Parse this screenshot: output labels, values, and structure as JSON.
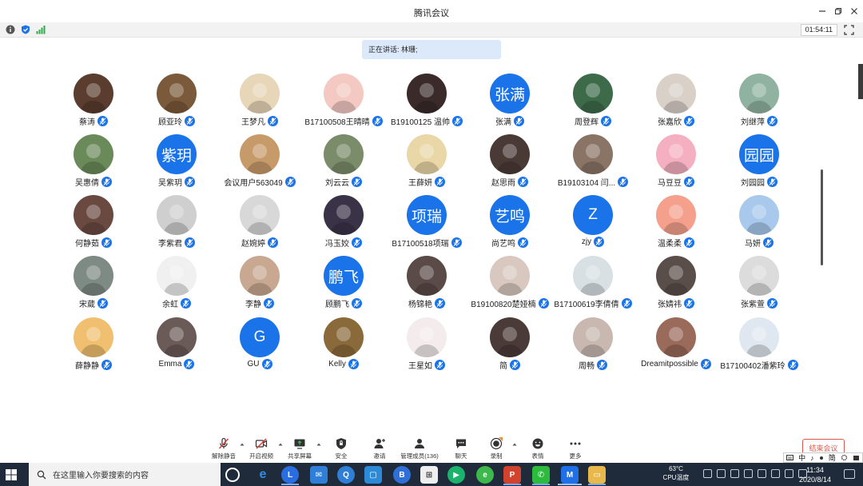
{
  "window": {
    "title": "腾讯会议",
    "timer": "01:54:11"
  },
  "speaking": {
    "text": "正在讲话: 林珊;"
  },
  "participants": [
    {
      "name": "蔡涛",
      "avatar_text": "",
      "avatar_color": "#5a3d2e"
    },
    {
      "name": "顾亚玲",
      "avatar_text": "",
      "avatar_color": "#7a5a3a"
    },
    {
      "name": "王梦凡",
      "avatar_text": "",
      "avatar_color": "#e8d6b8"
    },
    {
      "name": "B17100508王晴晴",
      "avatar_text": "",
      "avatar_color": "#f3c9c2"
    },
    {
      "name": "B19100125 温帅",
      "avatar_text": "",
      "avatar_color": "#3a2a2a"
    },
    {
      "name": "张满",
      "avatar_text": "张满",
      "avatar_color": "#1a73e8"
    },
    {
      "name": "周登辉",
      "avatar_text": "",
      "avatar_color": "#3d6b4a"
    },
    {
      "name": "张嘉欣",
      "avatar_text": "",
      "avatar_color": "#d9d0c8"
    },
    {
      "name": "刘继萍",
      "avatar_text": "",
      "avatar_color": "#8fb3a0"
    },
    {
      "name": "吴惠倩",
      "avatar_text": "",
      "avatar_color": "#6b8a5a"
    },
    {
      "name": "吴紫玥",
      "avatar_text": "紫玥",
      "avatar_color": "#1a73e8"
    },
    {
      "name": "会议用户563049",
      "avatar_text": "",
      "avatar_color": "#c79a6a"
    },
    {
      "name": "刘云云",
      "avatar_text": "",
      "avatar_color": "#7a8c6a"
    },
    {
      "name": "王薛妍",
      "avatar_text": "",
      "avatar_color": "#e9d7a8"
    },
    {
      "name": "赵思雨",
      "avatar_text": "",
      "avatar_color": "#4a3a36"
    },
    {
      "name": "B19103104 闫...",
      "avatar_text": "",
      "avatar_color": "#8a7466"
    },
    {
      "name": "马豆豆",
      "avatar_text": "",
      "avatar_color": "#f4b0c0"
    },
    {
      "name": "刘园园",
      "avatar_text": "园园",
      "avatar_color": "#1a73e8"
    },
    {
      "name": "何静茹",
      "avatar_text": "",
      "avatar_color": "#6a4a40"
    },
    {
      "name": "李紫君",
      "avatar_text": "",
      "avatar_color": "#cfcfcf"
    },
    {
      "name": "赵婉婷",
      "avatar_text": "",
      "avatar_color": "#d8d8d8"
    },
    {
      "name": "冯玉姣",
      "avatar_text": "",
      "avatar_color": "#3a3348"
    },
    {
      "name": "B17100518项瑞",
      "avatar_text": "项瑞",
      "avatar_color": "#1a73e8"
    },
    {
      "name": "尚艺鸣",
      "avatar_text": "艺鸣",
      "avatar_color": "#1a73e8"
    },
    {
      "name": "zjy",
      "avatar_text": "Z",
      "avatar_color": "#1a73e8"
    },
    {
      "name": "温柔柔",
      "avatar_text": "",
      "avatar_color": "#f4a08c"
    },
    {
      "name": "马妍",
      "avatar_text": "",
      "avatar_color": "#a8c8ec"
    },
    {
      "name": "宋葳",
      "avatar_text": "",
      "avatar_color": "#7e8a84"
    },
    {
      "name": "余虹",
      "avatar_text": "",
      "avatar_color": "#f0f0f0"
    },
    {
      "name": "李静",
      "avatar_text": "",
      "avatar_color": "#c8a890"
    },
    {
      "name": "顾鹏飞",
      "avatar_text": "鹏飞",
      "avatar_color": "#1a73e8"
    },
    {
      "name": "杨锦艳",
      "avatar_text": "",
      "avatar_color": "#5a4a48"
    },
    {
      "name": "B19100820楚娅楠",
      "avatar_text": "",
      "avatar_color": "#d8c8c0"
    },
    {
      "name": "B17100619李倩倩",
      "avatar_text": "",
      "avatar_color": "#d8e0e4"
    },
    {
      "name": "张婧祎",
      "avatar_text": "",
      "avatar_color": "#5a4e4a"
    },
    {
      "name": "张紫萱",
      "avatar_text": "",
      "avatar_color": "#dcdcdc"
    },
    {
      "name": "薛静静",
      "avatar_text": "",
      "avatar_color": "#f0c070"
    },
    {
      "name": "Emma",
      "avatar_text": "",
      "avatar_color": "#6a5a58"
    },
    {
      "name": "GU",
      "avatar_text": "G",
      "avatar_color": "#1a73e8"
    },
    {
      "name": "Kelly",
      "avatar_text": "",
      "avatar_color": "#8a6a3a"
    },
    {
      "name": "王星如",
      "avatar_text": "",
      "avatar_color": "#f4ecec"
    },
    {
      "name": "简",
      "avatar_text": "",
      "avatar_color": "#4a3a38"
    },
    {
      "name": "周畅",
      "avatar_text": "",
      "avatar_color": "#c8b8b0"
    },
    {
      "name": "Dreamitpossible",
      "avatar_text": "",
      "avatar_color": "#9a6a5a"
    },
    {
      "name": "B17100402潘紫玲",
      "avatar_text": "",
      "avatar_color": "#dfe8f0"
    }
  ],
  "toolbar": {
    "unmute": "解除静音",
    "video": "开启视频",
    "share": "共享屏幕",
    "security": "安全",
    "invite": "邀请",
    "members": "管理成员(136)",
    "chat": "聊天",
    "record": "录制",
    "reactions": "表情",
    "more": "更多",
    "end": "结束会议"
  },
  "ime": [
    "中",
    "♪",
    "简"
  ],
  "taskbar": {
    "search_placeholder": "在这里输入你要搜索的内容",
    "cpu_temp": "63°C",
    "cpu_label": "CPU温度",
    "time": "11:34",
    "date": "2020/8/14"
  }
}
